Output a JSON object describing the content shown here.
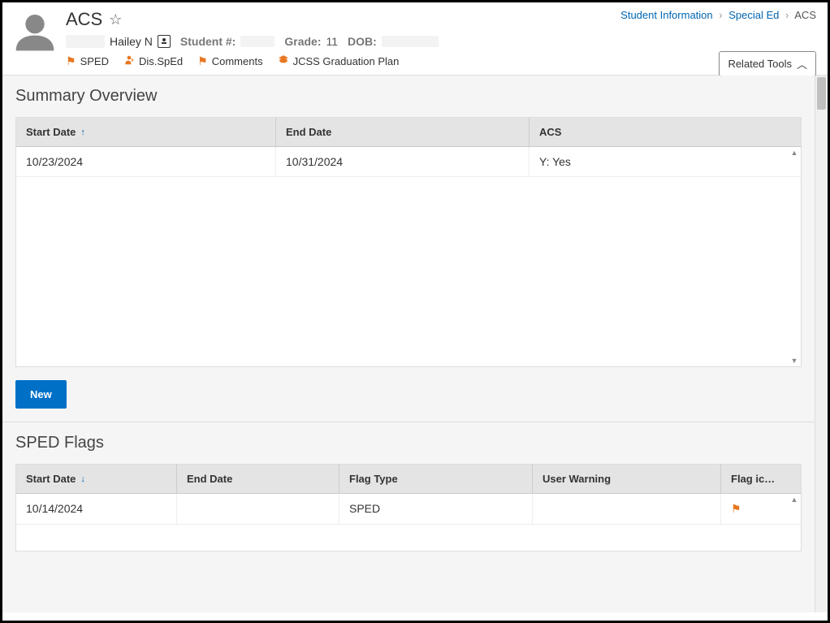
{
  "header": {
    "title": "ACS",
    "breadcrumb": {
      "item1": "Student Information",
      "item2": "Special Ed",
      "item3": "ACS"
    },
    "student": {
      "name": "Hailey N",
      "student_num_label": "Student #:",
      "grade_label": "Grade:",
      "grade_value": "11",
      "dob_label": "DOB:"
    },
    "flags": {
      "sped": "SPED",
      "dis_sped": "Dis.SpEd",
      "comments": "Comments",
      "grad_plan": "JCSS Graduation Plan"
    },
    "related_tools": "Related Tools"
  },
  "summary": {
    "section_title": "Summary Overview",
    "columns": {
      "start_date": "Start Date",
      "end_date": "End Date",
      "acs": "ACS"
    },
    "rows": [
      {
        "start_date": "10/23/2024",
        "end_date": "10/31/2024",
        "acs": "Y: Yes"
      }
    ],
    "new_button": "New"
  },
  "sped_flags": {
    "section_title": "SPED Flags",
    "columns": {
      "start_date": "Start Date",
      "end_date": "End Date",
      "flag_type": "Flag Type",
      "user_warning": "User Warning",
      "flag_icon": "Flag ic…"
    },
    "rows": [
      {
        "start_date": "10/14/2024",
        "end_date": "",
        "flag_type": "SPED",
        "user_warning": ""
      }
    ]
  }
}
